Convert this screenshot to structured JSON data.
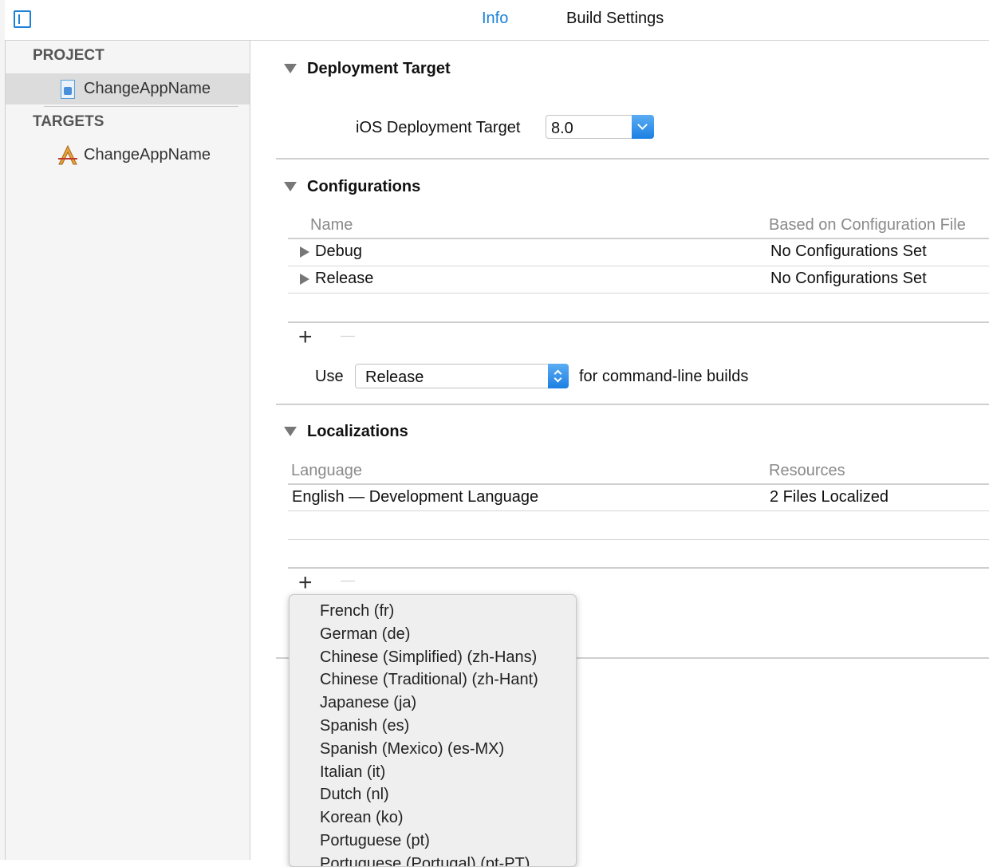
{
  "tabs": {
    "info": "Info",
    "build_settings": "Build Settings"
  },
  "sidebar": {
    "project_heading": "PROJECT",
    "project_item": "ChangeAppName",
    "targets_heading": "TARGETS",
    "target_item": "ChangeAppName"
  },
  "deployment": {
    "title": "Deployment Target",
    "ios_label": "iOS Deployment Target",
    "ios_value": "8.0"
  },
  "configurations": {
    "title": "Configurations",
    "col_name": "Name",
    "col_based": "Based on Configuration File",
    "rows": [
      {
        "name": "Debug",
        "based": "No Configurations Set"
      },
      {
        "name": "Release",
        "based": "No Configurations Set"
      }
    ],
    "add": "+",
    "use_label": "Use",
    "use_value": "Release",
    "use_suffix": "for command-line builds"
  },
  "localizations": {
    "title": "Localizations",
    "col_language": "Language",
    "col_resources": "Resources",
    "rows": [
      {
        "language": "English — Development Language",
        "resources": "2 Files Localized"
      }
    ],
    "add": "+"
  },
  "language_menu": [
    "French (fr)",
    "German (de)",
    "Chinese (Simplified) (zh-Hans)",
    "Chinese (Traditional) (zh-Hant)",
    "Japanese (ja)",
    "Spanish (es)",
    "Spanish (Mexico) (es-MX)",
    "Italian (it)",
    "Dutch (nl)",
    "Korean (ko)",
    "Portuguese (pt)",
    "Portuguese (Portugal) (pt-PT)"
  ]
}
